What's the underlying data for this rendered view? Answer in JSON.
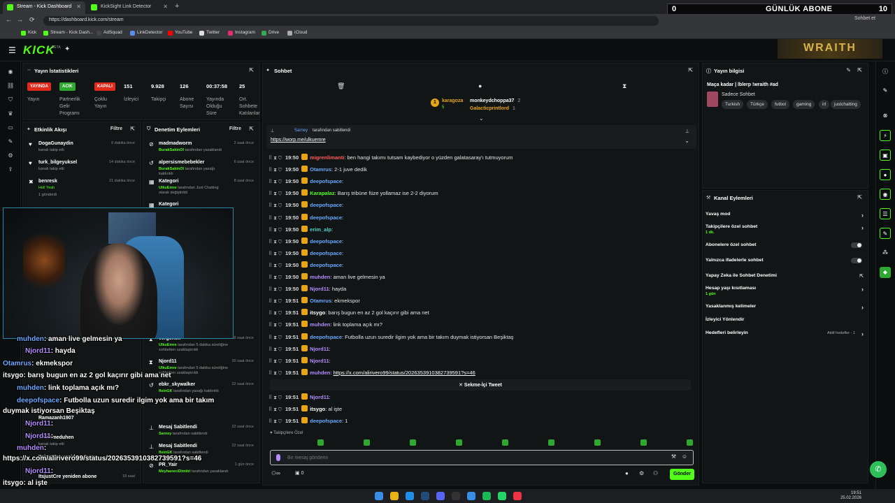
{
  "browser": {
    "tabs": [
      {
        "title": "Stream - Kick Dashboard",
        "active": true
      },
      {
        "title": "KickSight Link Detector",
        "active": false
      }
    ],
    "url": "https://dashboard.kick.com/stream",
    "bookmarks": [
      "Kick",
      "Stream - Kick Dash...",
      "AdSquad",
      "LinkDetector",
      "YouTube",
      "Twitter",
      "Instagram",
      "Drive",
      "iCloud"
    ]
  },
  "overlay": {
    "left_number": "0",
    "title": "GÜNLÜK ABONE",
    "right_number": "10"
  },
  "header": {
    "logo": "KICK",
    "beta": "BETA",
    "chat_button": "Sohbet et"
  },
  "stats": {
    "title": "Yayın İstatistikleri",
    "statuses": [
      {
        "badge": "YAYINDA",
        "label": "Yayın",
        "color": "#e1291c"
      },
      {
        "badge": "ACIK",
        "label": "Partnerlik Gelir Programı",
        "color": "#2fa832"
      },
      {
        "badge": "KAPALI",
        "label": "Çoklu Yayın",
        "color": "#e1291c"
      }
    ],
    "metrics": [
      {
        "value": "151",
        "label": "İzleyici"
      },
      {
        "value": "9.928",
        "label": "Takipçi"
      },
      {
        "value": "126",
        "label": "Abone Sayısı"
      },
      {
        "value": "00:37:58",
        "label": "Yayında Olduğu Süre"
      },
      {
        "value": "25",
        "label": "Ort. Sohbete Katılanlar"
      }
    ]
  },
  "activity": {
    "title": "Etkinlik Akışı",
    "filter": "Filtre",
    "items": [
      {
        "name": "DogaGunaydin",
        "desc": "kanalı takip etti",
        "time": "9 dakika önce"
      },
      {
        "name": "turk_bilgeyuksel",
        "desc": "kanalı takip etti",
        "time": "14 dakika önce"
      },
      {
        "name": "benresk",
        "desc": "Hell Yeah",
        "extra": "1 gönderdi",
        "time": "21 dakika önce"
      }
    ],
    "lower_items": [
      {
        "name": "Ramazanh1907",
        "time": "",
        "desc": ""
      },
      {
        "name": "Gelenmeduhen",
        "time": "",
        "desc": "kanalı takip etti"
      },
      {
        "name": "ItsjustCre yeniden abone",
        "time": "18 saat",
        "desc": ""
      },
      {
        "name": "ItsjustCre yeniden abone",
        "time": "18 saat",
        "desc": ""
      }
    ]
  },
  "moderation": {
    "title": "Denetim Eylemleri",
    "filter": "Filtre",
    "items": [
      {
        "name": "madmadworm",
        "who": "BurakSakinOl",
        "desc": "tarafından yasaklandı",
        "time": "2 saat önce"
      },
      {
        "name": "alpersismebebekler",
        "who": "BurakSakinOl",
        "desc": "tarafından yasağı kaldırıldı",
        "time": "6 saat önce"
      },
      {
        "name": "Kategori",
        "who": "UlkuEmre",
        "desc": "tarafından Just Chatting olarak değiştirildi",
        "time": "8 saat önce"
      },
      {
        "name": "Kategori",
        "who": "",
        "desc": "",
        "time": ""
      },
      {
        "name": "vergenen",
        "who": "UlkuEmre",
        "desc": "tarafından 5 dakika süreliğine sohbetten uzaklaştırıldı",
        "time": "18 saat önce"
      },
      {
        "name": "Njord11",
        "who": "UlkuEmre",
        "desc": "tarafından 5 dakika süreliğine sohbetten uzaklaştırıldı",
        "time": "20 saat önce"
      },
      {
        "name": "ebkr_skywalker",
        "who": "fleinGK",
        "desc": "tarafından yasağı kaldırıldı",
        "time": "22 saat önce"
      },
      {
        "name": "Mesaj Sabitlendi",
        "who": "Sarney",
        "desc": "tarafından sabitlendi",
        "time": "22 saat önce"
      },
      {
        "name": "Mesaj Sabitlendi",
        "who": "fleinGK",
        "desc": "tarafından sabitlendi",
        "time": "22 saat önce"
      },
      {
        "name": "PR_Yair",
        "who": "MeyhaneciDimitri",
        "desc": "tarafından yasaklandı",
        "time": "1 gün önce"
      }
    ]
  },
  "stream_overlay_chat": [
    {
      "name": "muhden",
      "text": ": aman live gelmesin ya"
    },
    {
      "name": "Njord11",
      "text": ": hayda"
    },
    {
      "name": "Otamrus",
      "text": ": ekmekspor"
    },
    {
      "name": "itsygo",
      "text": ": barış bugun en az 2 gol kaçırır gibi ama net"
    },
    {
      "name": "muhden",
      "text": ": link toplama açık mı?"
    },
    {
      "name": "deepofspace",
      "text": ": Futbolla uzun suredir ilgim yok ama bir takım"
    },
    {
      "name": "",
      "text": "duymak istiyorsan Beşiktaş"
    },
    {
      "name": "Njord11",
      "text": ":"
    },
    {
      "name": "Njord11",
      "text": ":"
    },
    {
      "name": "muhden",
      "text": ":"
    },
    {
      "name": "",
      "text": "https://x.com/alirivero99/status/2026353910382739591?s=46"
    },
    {
      "name": "Njord11",
      "text": ":"
    },
    {
      "name": "itsygo",
      "text": ": al işte"
    },
    {
      "name": "deepofspace",
      "text": ": 1"
    }
  ],
  "chat": {
    "title": "Sohbet",
    "leaderboard": [
      {
        "rank": "1",
        "name": "karagoza",
        "sub": "5"
      },
      {
        "name": "monkeydchoppa37",
        "count": "2"
      },
      {
        "name": "Galacticprintlord",
        "count": "1"
      }
    ],
    "pinned_by": "Sarney",
    "pinned_suffix": "tarafından sabitlendi",
    "pinned_link": "https://worp.me/ulkuemre",
    "messages": [
      {
        "time": "19:50",
        "user": "migrenlimanti",
        "color": "#ff5a5a",
        "text": ": ben hangi takımı tutsam kaybediyor o yüzden galatasaray'ı tutmuyorum"
      },
      {
        "time": "19:50",
        "user": "Otamrus",
        "color": "#69a9ff",
        "text": ": 2-1 juve dedik"
      },
      {
        "time": "19:50",
        "user": "deepofspace",
        "color": "#69a9ff",
        "text": ":"
      },
      {
        "time": "19:50",
        "user": "Karapalaz",
        "color": "#53fc18",
        "text": ": Barış tribüne füze yollamaz ise 2-2 diyorum"
      },
      {
        "time": "19:50",
        "user": "deepofspace",
        "color": "#69a9ff",
        "text": ":"
      },
      {
        "time": "19:50",
        "user": "deepofspace",
        "color": "#69a9ff",
        "text": ":"
      },
      {
        "time": "19:50",
        "user": "erim_alp",
        "color": "#4bd0c4",
        "text": ":"
      },
      {
        "time": "19:50",
        "user": "deepofspace",
        "color": "#69a9ff",
        "text": ":"
      },
      {
        "time": "19:50",
        "user": "deepofspace",
        "color": "#69a9ff",
        "text": ":"
      },
      {
        "time": "19:50",
        "user": "deepofspace",
        "color": "#69a9ff",
        "text": ":"
      },
      {
        "time": "19:50",
        "user": "muhden",
        "color": "#b48cff",
        "text": ": aman live gelmesin ya"
      },
      {
        "time": "19:50",
        "user": "Njord11",
        "color": "#b48cff",
        "text": ": hayda"
      },
      {
        "time": "19:51",
        "user": "Otamrus",
        "color": "#69a9ff",
        "text": ": ekmekspor"
      },
      {
        "time": "19:51",
        "user": "itsygo",
        "color": "#ffffff",
        "text": ": barış bugun en az 2 gol kaçırır gibi ama net"
      },
      {
        "time": "19:51",
        "user": "muhden",
        "color": "#b48cff",
        "text": ": link toplama açık mı?"
      },
      {
        "time": "19:51",
        "user": "deepofspace",
        "color": "#69a9ff",
        "text": ": Futbolla uzun suredir ilgim yok ama bir takım duymak istiyorsan Beşiktaş"
      },
      {
        "time": "19:51",
        "user": "Njord11",
        "color": "#b48cff",
        "text": ":"
      },
      {
        "time": "19:51",
        "user": "Njord11",
        "color": "#b48cff",
        "text": ":"
      },
      {
        "time": "19:51",
        "user": "muhden",
        "color": "#b48cff",
        "text": ": ",
        "link": "https://x.com/alirivero99/status/2026353910382739591?s=46"
      }
    ],
    "tweet_button": "Sekme-İçi Tweet",
    "after_messages": [
      {
        "time": "19:51",
        "user": "Njord11",
        "color": "#b48cff",
        "text": ":"
      },
      {
        "time": "19:51",
        "user": "itsygo",
        "color": "#ffffff",
        "text": ": al işte"
      },
      {
        "time": "19:51",
        "user": "deepofspace",
        "color": "#69a9ff",
        "text": ": 1"
      }
    ],
    "followers_label": "Takipçilere Özel",
    "input_placeholder": "Bir mesaj gönderin",
    "bottom_count": "0",
    "send_label": "Gönder"
  },
  "stream_info": {
    "title": "Yayın bilgisi",
    "stream_title": "Maça kadar | lblerp !wraith #ad",
    "category": "Sadece Sohbet",
    "tags": [
      "Turkish",
      "Türkçe",
      "futbol",
      "gaming",
      "irl",
      "justchatting"
    ]
  },
  "channel_actions": {
    "title": "Kanal Eylemleri",
    "items": [
      {
        "label": "Yavaş mod",
        "type": "chevron",
        "sub": ""
      },
      {
        "label": "Takipçilere özel sohbet",
        "type": "chevron",
        "sub": "1 dk."
      },
      {
        "label": "Abonelere özel sohbet",
        "type": "toggle",
        "sub": ""
      },
      {
        "label": "Yalnızca ifadelerle sohbet",
        "type": "toggle",
        "sub": ""
      },
      {
        "label": "Yapay Zeka ile Sohbet Denetimi",
        "type": "external",
        "sub": ""
      },
      {
        "label": "Hesap yaşı kısıtlaması",
        "type": "chevron",
        "sub": "1 gün"
      },
      {
        "label": "Yasaklanmış kelimeler",
        "type": "chevron",
        "sub": ""
      },
      {
        "label": "İzleyici Yönlendir",
        "type": "none",
        "sub": ""
      },
      {
        "label": "Hedefleri belirleyin",
        "type": "chevron",
        "sub": "",
        "note": "Aktif hedefler - 1"
      }
    ]
  },
  "taskbar": {
    "time": "19:51",
    "date": "25.02.2026"
  }
}
